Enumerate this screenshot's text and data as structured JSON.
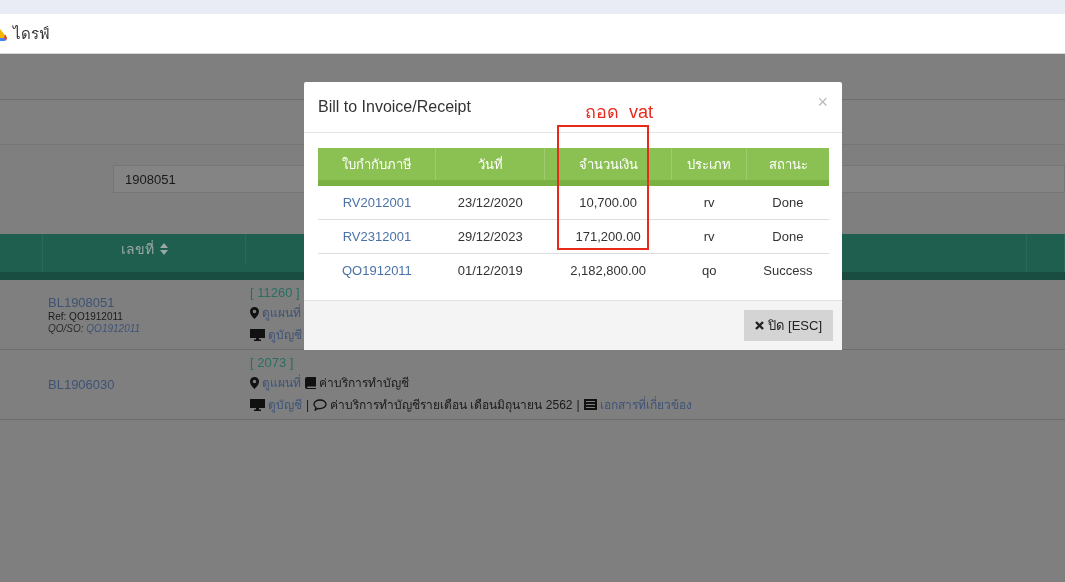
{
  "bookmarks_bar": {
    "bookmark": "ไดรฟ์"
  },
  "search": {
    "value": "1908051"
  },
  "table": {
    "columns": [
      "เลขที่"
    ],
    "rows": [
      {
        "number": "BL1908051",
        "ref": "Ref: QO1912011",
        "qo_so_label": "QO/SO:",
        "qo_so": "QO1912011",
        "code": "[ 11260 ]",
        "line_2": [
          {
            "kind": "map",
            "text": "ดูแผนที่"
          }
        ],
        "line_3": [
          {
            "kind": "account",
            "text": "ดูบัญชี"
          }
        ]
      },
      {
        "number": "BL1906030",
        "code": "[ 2073 ]",
        "line_2": [
          {
            "kind": "map",
            "text": "ดูแผนที่"
          },
          {
            "kind": "book",
            "text": "ค่าบริการทำบัญชี"
          }
        ],
        "line_3": [
          {
            "kind": "account",
            "text": "ดูบัญชี"
          },
          {
            "kind": "separator",
            "text": "|"
          },
          {
            "kind": "comment",
            "text": "ค่าบริการทำบัญชีรายเดือน เดือนมิถุนายน 2562"
          },
          {
            "kind": "separator",
            "text": "|"
          },
          {
            "kind": "document",
            "text": "เอกสารที่เกี่ยวข้อง"
          }
        ]
      }
    ]
  },
  "modal": {
    "title": "Bill to Invoice/Receipt",
    "close": "×",
    "annotation": "ถอด  vat",
    "columns": [
      "ใบกำกับภาษี",
      "วันที่",
      "จำนวนเงิน",
      "ประเภท",
      "สถานะ"
    ],
    "rows": [
      {
        "document": "RV2012001",
        "date": "23/12/2020",
        "amount": "10,700.00",
        "type": "rv",
        "status": "Done"
      },
      {
        "document": "RV2312001",
        "date": "29/12/2023",
        "amount": "171,200.00",
        "type": "rv",
        "status": "Done"
      },
      {
        "document": "QO1912011",
        "date": "01/12/2019",
        "amount": "2,182,800.00",
        "type": "qo",
        "status": "Success"
      }
    ],
    "close_button": "ปิด [ESC]"
  }
}
